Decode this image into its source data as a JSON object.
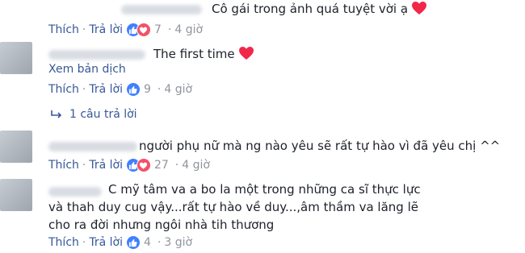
{
  "comments": [
    {
      "text": "Cô gái trong ảnh quá tuyệt vời ạ",
      "has_heart": true,
      "actions": {
        "like": "Thích",
        "reply": "Trả lời",
        "count": "7",
        "time": "4 giờ",
        "reactions": [
          "like-icon",
          "love-icon"
        ]
      }
    },
    {
      "text": "The first time",
      "has_heart": true,
      "translate": "Xem bản dịch",
      "actions": {
        "like": "Thích",
        "reply": "Trả lời",
        "count": "9",
        "time": "4 giờ",
        "reactions": [
          "like-icon"
        ]
      },
      "replies": "1 câu trả lời"
    },
    {
      "text": "người phụ nữ mà ng nào yêu sẽ rất tự hào vì đã yêu chị ^^",
      "has_heart": false,
      "actions": {
        "like": "Thích",
        "reply": "Trả lời",
        "count": "27",
        "time": "4 giờ",
        "reactions": [
          "like-icon",
          "love-icon"
        ]
      }
    },
    {
      "text": "C mỹ tâm va a bo la một trong những ca sĩ thực lực và thah duy cug vậy...rất tự hào về duy...,âm thầm va lăng lẽ cho ra đời nhưng ngôi nhà tih thương",
      "has_heart": false,
      "actions": {
        "like": "Thích",
        "reply": "Trả lời",
        "count": "4",
        "time": "3 giờ",
        "reactions": [
          "like-icon"
        ]
      }
    }
  ],
  "colors": {
    "link": "#365899",
    "muted": "#90949c",
    "like": "#4080ff",
    "love": "#f25268",
    "heart": "#f0284a"
  }
}
